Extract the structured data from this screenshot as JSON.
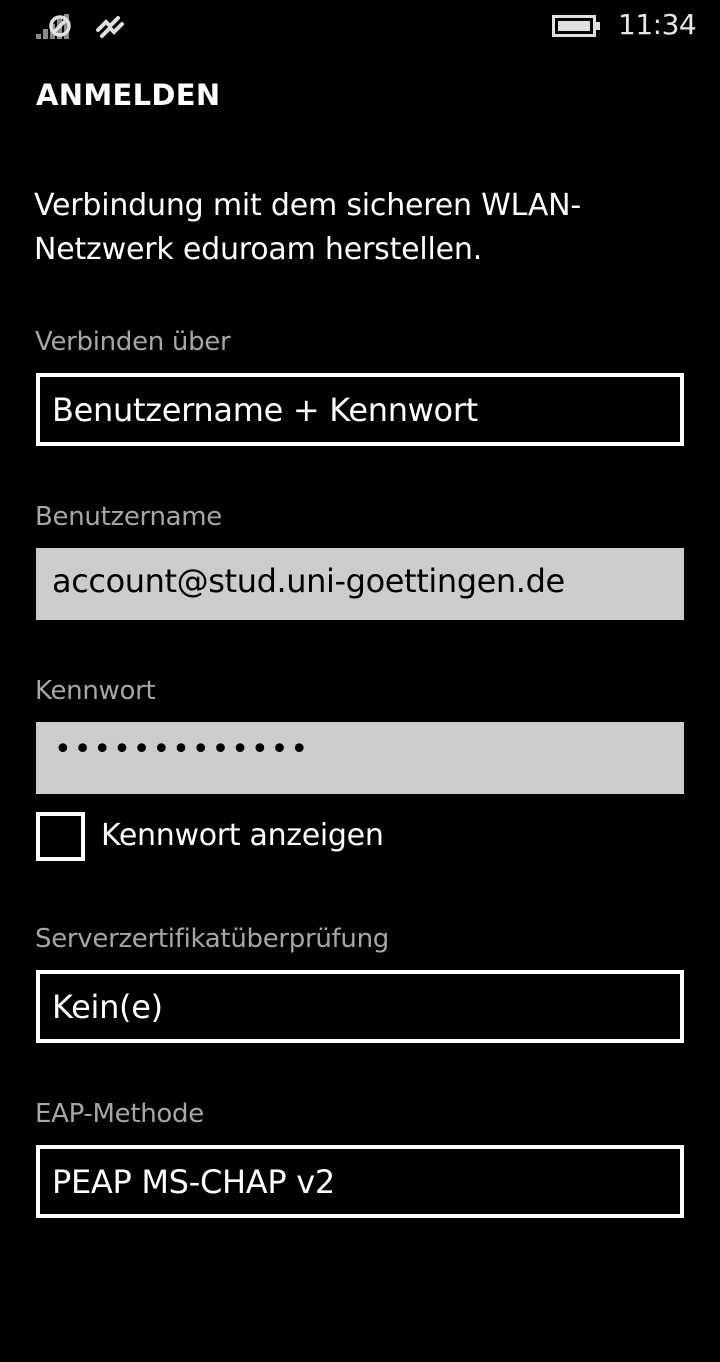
{
  "status_bar": {
    "time": "11:34",
    "icons": [
      "signal-no-sim-icon",
      "data-sync-icon",
      "battery-icon"
    ]
  },
  "page": {
    "title": "ANMELDEN",
    "intro": "Verbindung mit dem sicheren WLAN-Netzwerk eduroam herstellen."
  },
  "form": {
    "connect_via": {
      "label": "Verbinden über",
      "value": "Benutzername + Kennwort"
    },
    "username": {
      "label": "Benutzername",
      "value": "account@stud.uni-goettingen.de"
    },
    "password": {
      "label": "Kennwort",
      "value": "•••••••••••••"
    },
    "show_password": {
      "label": "Kennwort anzeigen",
      "checked": false
    },
    "server_cert": {
      "label": "Serverzertifikatüberprüfung",
      "value": "Kein(e)"
    },
    "eap_method": {
      "label": "EAP-Methode",
      "value": "PEAP MS-CHAP v2"
    }
  },
  "colors": {
    "background": "#000000",
    "text": "#ffffff",
    "label": "#a6a6a6",
    "textbox_fill": "#cccccc"
  }
}
